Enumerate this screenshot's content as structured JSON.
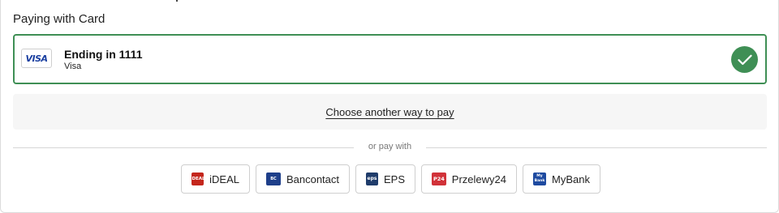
{
  "header": {
    "title": "Paying with Card"
  },
  "selected_card": {
    "brand_logo_text": "VISA",
    "title": "Ending in 1111",
    "brand": "Visa",
    "status_icon": "checkmark-circle-icon",
    "accent_color": "#3f8f55"
  },
  "alternate": {
    "link_label": "Choose another way to pay"
  },
  "divider": {
    "label": "or pay with"
  },
  "methods": [
    {
      "label": "iDEAL",
      "logo_text": "iDEAL",
      "color": "#c4261c"
    },
    {
      "label": "Bancontact",
      "logo_text": "BC",
      "color": "#1e3f8a"
    },
    {
      "label": "EPS",
      "logo_text": "eps",
      "color": "#1f3c6b"
    },
    {
      "label": "Przelewy24",
      "logo_text": "P24",
      "color": "#d13239"
    },
    {
      "label": "MyBank",
      "logo_text": "My Bank",
      "color": "#1e4aa0"
    }
  ]
}
